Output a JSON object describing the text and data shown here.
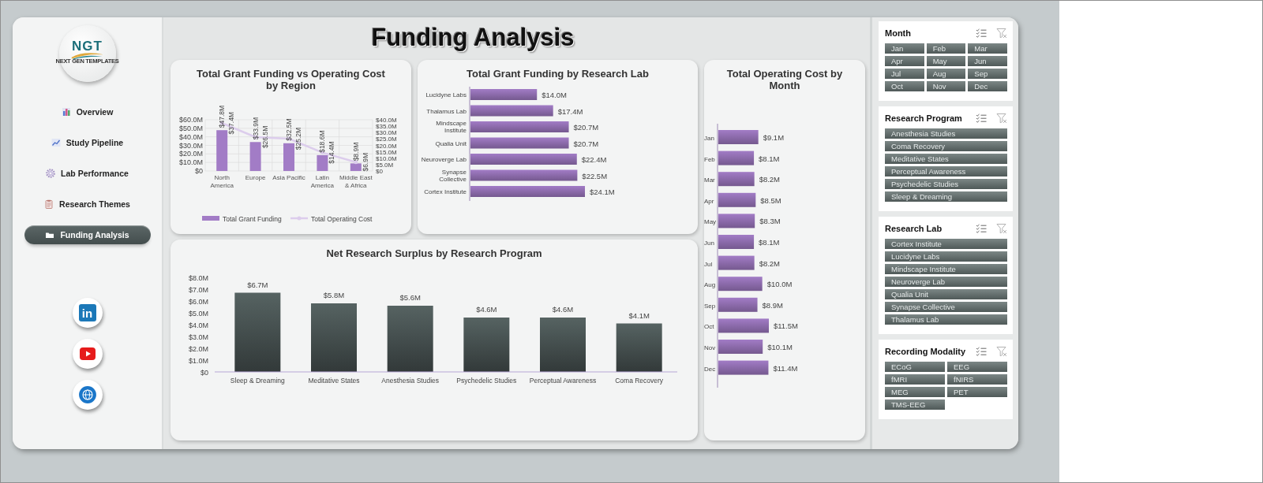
{
  "title": "Funding Analysis",
  "logo": {
    "text": "NGT",
    "tagline": "NEXT GEN TEMPLATES"
  },
  "nav": [
    {
      "label": "Overview",
      "selected": false
    },
    {
      "label": "Study Pipeline",
      "selected": false
    },
    {
      "label": "Lab Performance",
      "selected": false
    },
    {
      "label": "Research Themes",
      "selected": false
    },
    {
      "label": "Funding Analysis",
      "selected": true
    }
  ],
  "social": [
    {
      "kind": "linkedin",
      "label": "in"
    },
    {
      "kind": "youtube"
    },
    {
      "kind": "web"
    }
  ],
  "charts": [
    {
      "chart_data": {
        "type": "bar",
        "title": "Total Grant Funding vs Operating Cost by Region",
        "categories": [
          "North America",
          "Europe",
          "Asia Pacific",
          "Latin America",
          "Middle East & Africa"
        ],
        "series": [
          {
            "name": "Total Grant Funding",
            "color": "#a27cc6",
            "values": [
              47.8,
              33.9,
              32.5,
              18.6,
              8.9
            ],
            "value_labels": [
              "$47.8M",
              "$33.9M",
              "$32.5M",
              "$18.6M",
              "$8.9M"
            ]
          },
          {
            "name": "Total Operating Cost",
            "type": "line",
            "axis": "y2",
            "color": "#dccdec",
            "values": [
              37.4,
              26.5,
              25.2,
              14.4,
              6.9
            ],
            "value_labels": [
              "$37.4M",
              "$26.5M",
              "$25.2M",
              "$14.4M",
              "$6.9M"
            ]
          }
        ],
        "ylim": [
          0,
          60
        ],
        "y2lim": [
          0,
          40
        ],
        "grid": true,
        "legend": "bottom",
        "yticks": [
          {
            "value": 0,
            "label": "$0"
          },
          {
            "value": 10,
            "label": "$10.0M"
          },
          {
            "value": 20,
            "label": "$20.0M"
          },
          {
            "value": 30,
            "label": "$30.0M"
          },
          {
            "value": 40,
            "label": "$40.0M"
          },
          {
            "value": 50,
            "label": "$50.0M"
          },
          {
            "value": 60,
            "label": "$60.0M"
          }
        ],
        "y2ticks": [
          {
            "value": 0,
            "label": "$0"
          },
          {
            "value": 5,
            "label": "$5.0M"
          },
          {
            "value": 10,
            "label": "$10.0M"
          },
          {
            "value": 15,
            "label": "$15.0M"
          },
          {
            "value": 20,
            "label": "$20.0M"
          },
          {
            "value": 25,
            "label": "$25.0M"
          },
          {
            "value": 30,
            "label": "$30.0M"
          },
          {
            "value": 35,
            "label": "$35.0M"
          },
          {
            "value": 40,
            "label": "$40.0M"
          }
        ],
        "data_labels": true
      }
    },
    {
      "chart_data": {
        "type": "bar",
        "orientation": "horizontal",
        "title": "Total Grant Funding by Research Lab",
        "categories": [
          "Lucidyne Labs",
          "Thalamus Lab",
          "Mindscape Institute",
          "Qualia Unit",
          "Neuroverge Lab",
          "Synapse Collective",
          "Cortex Institute"
        ],
        "series": [
          {
            "color": "#a27cc6",
            "values": [
              14.0,
              17.4,
              20.7,
              20.7,
              22.4,
              22.5,
              24.1
            ],
            "value_labels": [
              "$14.0M",
              "$17.4M",
              "$20.7M",
              "$20.7M",
              "$22.4M",
              "$22.5M",
              "$24.1M"
            ]
          }
        ],
        "data_labels": true
      }
    },
    {
      "chart_data": {
        "type": "bar",
        "orientation": "horizontal",
        "title": "Total Operating Cost by Month",
        "categories": [
          "Jan",
          "Feb",
          "Mar",
          "Apr",
          "May",
          "Jun",
          "Jul",
          "Aug",
          "Sep",
          "Oct",
          "Nov",
          "Dec"
        ],
        "series": [
          {
            "color": "#a27cc6",
            "values": [
              9.1,
              8.1,
              8.2,
              8.5,
              8.3,
              8.1,
              8.2,
              10.0,
              8.9,
              11.5,
              10.1,
              11.4
            ],
            "value_labels": [
              "$9.1M",
              "$8.1M",
              "$8.2M",
              "$8.5M",
              "$8.3M",
              "$8.1M",
              "$8.2M",
              "$10.0M",
              "$8.9M",
              "$11.5M",
              "$10.1M",
              "$11.4M"
            ]
          }
        ],
        "data_labels": true
      }
    },
    {
      "chart_data": {
        "type": "bar",
        "title": "Net Research Surplus by Research Program",
        "categories": [
          "Sleep & Dreaming",
          "Meditative States",
          "Anesthesia Studies",
          "Psychedelic Studies",
          "Perceptual Awareness",
          "Coma Recovery"
        ],
        "series": [
          {
            "color": "#566362",
            "values": [
              6.7,
              5.8,
              5.6,
              4.6,
              4.6,
              4.1
            ],
            "value_labels": [
              "$6.7M",
              "$5.8M",
              "$5.6M",
              "$4.6M",
              "$4.6M",
              "$4.1M"
            ]
          }
        ],
        "ylim": [
          0,
          8
        ],
        "yticks": [
          {
            "value": 0,
            "label": "$0"
          },
          {
            "value": 1,
            "label": "$1.0M"
          },
          {
            "value": 2,
            "label": "$2.0M"
          },
          {
            "value": 3,
            "label": "$3.0M"
          },
          {
            "value": 4,
            "label": "$4.0M"
          },
          {
            "value": 5,
            "label": "$5.0M"
          },
          {
            "value": 6,
            "label": "$6.0M"
          },
          {
            "value": 7,
            "label": "$7.0M"
          },
          {
            "value": 8,
            "label": "$8.0M"
          }
        ],
        "data_labels": true
      }
    }
  ],
  "slicers": [
    {
      "title": "Month",
      "items": [
        {
          "label": "Jan",
          "selected": true
        },
        {
          "label": "Feb",
          "selected": true
        },
        {
          "label": "Mar",
          "selected": true
        },
        {
          "label": "Apr",
          "selected": true
        },
        {
          "label": "May",
          "selected": true
        },
        {
          "label": "Jun",
          "selected": true
        },
        {
          "label": "Jul",
          "selected": true
        },
        {
          "label": "Aug",
          "selected": true
        },
        {
          "label": "Sep",
          "selected": true
        },
        {
          "label": "Oct",
          "selected": true
        },
        {
          "label": "Nov",
          "selected": true
        },
        {
          "label": "Dec",
          "selected": true
        }
      ]
    },
    {
      "title": "Research Program",
      "items": [
        {
          "label": "Anesthesia Studies",
          "selected": true
        },
        {
          "label": "Coma Recovery",
          "selected": true
        },
        {
          "label": "Meditative States",
          "selected": true
        },
        {
          "label": "Perceptual Awareness",
          "selected": true
        },
        {
          "label": "Psychedelic Studies",
          "selected": true
        },
        {
          "label": "Sleep & Dreaming",
          "selected": true
        }
      ]
    },
    {
      "title": "Research Lab",
      "items": [
        {
          "label": "Cortex Institute",
          "selected": true
        },
        {
          "label": "Lucidyne Labs",
          "selected": true
        },
        {
          "label": "Mindscape Institute",
          "selected": true
        },
        {
          "label": "Neuroverge Lab",
          "selected": true
        },
        {
          "label": "Qualia Unit",
          "selected": true
        },
        {
          "label": "Synapse Collective",
          "selected": true
        },
        {
          "label": "Thalamus Lab",
          "selected": true
        }
      ]
    },
    {
      "title": "Recording Modality",
      "items": [
        {
          "label": "ECoG",
          "selected": true
        },
        {
          "label": "EEG",
          "selected": true
        },
        {
          "label": "fMRI",
          "selected": true
        },
        {
          "label": "fNIRS",
          "selected": true
        },
        {
          "label": "MEG",
          "selected": true
        },
        {
          "label": "PET",
          "selected": true
        },
        {
          "label": "TMS-EEG",
          "selected": true
        }
      ]
    }
  ]
}
